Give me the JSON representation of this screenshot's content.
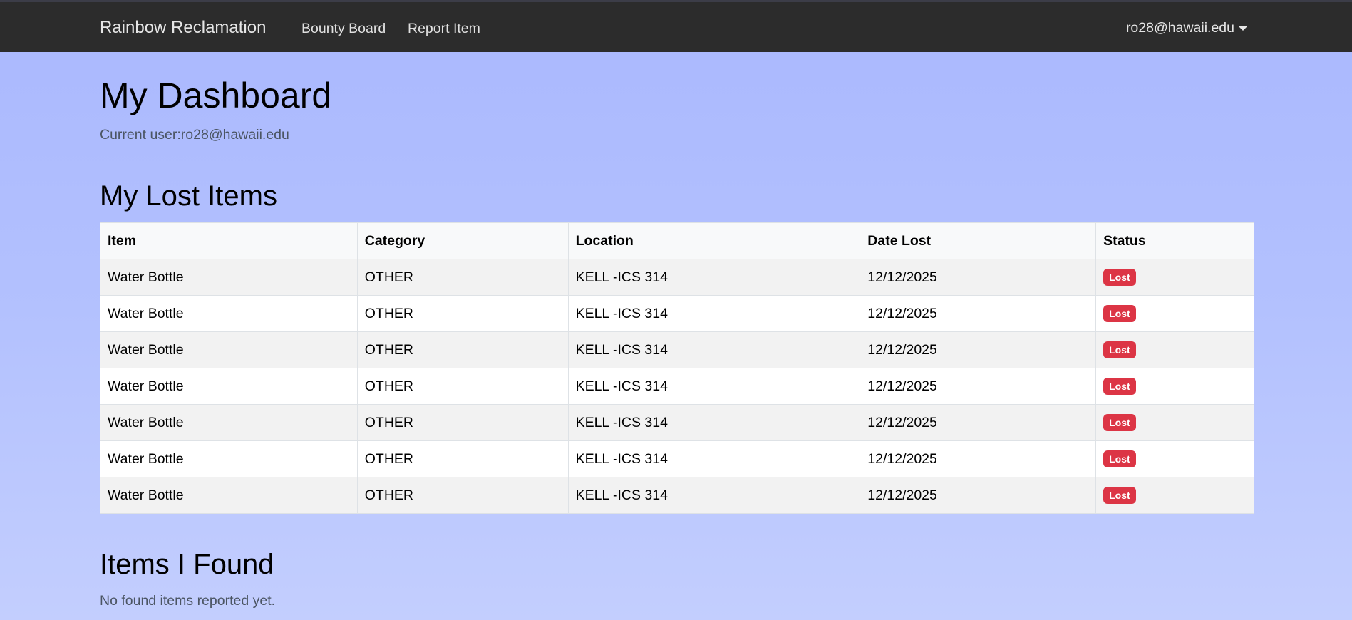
{
  "navbar": {
    "brand": "Rainbow Reclamation",
    "links": [
      "Bounty Board",
      "Report Item"
    ],
    "user": "ro28@hawaii.edu"
  },
  "page": {
    "title": "My Dashboard",
    "current_user": "Current user:ro28@hawaii.edu"
  },
  "lost": {
    "title": "My Lost Items",
    "headers": [
      "Item",
      "Category",
      "Location",
      "Date Lost",
      "Status"
    ],
    "rows": [
      [
        "Water Bottle",
        "OTHER",
        "KELL -ICS 314",
        "12/12/2025",
        "Lost"
      ],
      [
        "Water Bottle",
        "OTHER",
        "KELL -ICS 314",
        "12/12/2025",
        "Lost"
      ],
      [
        "Water Bottle",
        "OTHER",
        "KELL -ICS 314",
        "12/12/2025",
        "Lost"
      ],
      [
        "Water Bottle",
        "OTHER",
        "KELL -ICS 314",
        "12/12/2025",
        "Lost"
      ],
      [
        "Water Bottle",
        "OTHER",
        "KELL -ICS 314",
        "12/12/2025",
        "Lost"
      ],
      [
        "Water Bottle",
        "OTHER",
        "KELL -ICS 314",
        "12/12/2025",
        "Lost"
      ],
      [
        "Water Bottle",
        "OTHER",
        "KELL -ICS 314",
        "12/12/2025",
        "Lost"
      ]
    ]
  },
  "found": {
    "title": "Items I Found",
    "empty": "No found items reported yet."
  },
  "colors": {
    "navbar": "#2c2c2c",
    "badge": "#dc3545"
  }
}
